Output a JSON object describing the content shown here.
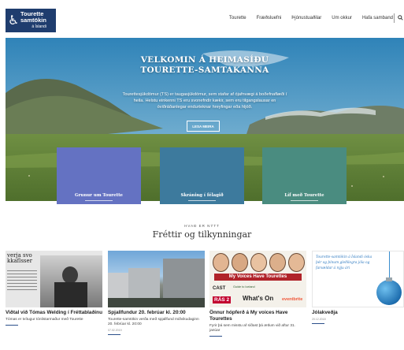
{
  "logo": {
    "line1": "Tourette",
    "line2": "samtökin",
    "line3": "á Íslandi"
  },
  "nav": {
    "items": [
      "Tourette",
      "Fræðsluefni",
      "Þjónustuaðilar",
      "Um okkur",
      "Hafa samband"
    ]
  },
  "hero": {
    "title_line1": "VELKOMIN Á HEIMASÍÐU",
    "title_line2": "TOURETTE-SAMTAKANNA",
    "text": "Tourettesjúkdómur (TS) er taugasjúkdómur, sem stafar af ójafnvægi á boðefnaflæði í heila. Helstu einkenni TS eru svonefndir kækir, sem eru tilgangslausar en óviðráðanlegar endurteknar hreyfingar eða hljóð.",
    "button": "LESA MEIRA"
  },
  "tiles": [
    {
      "label": "Grunur um Tourette",
      "color": "#6472c2"
    },
    {
      "label": "Skráning í félagið",
      "color": "#3d7a9d"
    },
    {
      "label": "Líf með Tourette",
      "color": "#4a8c80"
    }
  ],
  "news": {
    "eyebrow": "HVAÐ ER NÝTT",
    "title": "Fréttir og tilkynningar",
    "cards": [
      {
        "title": "Viðtal við Tómas Welding í Fréttablaðinu",
        "excerpt": "Tómas er tvítugur tónlistarmaður með Tourette",
        "date": "",
        "thumb_text": "verja svo\nkkaflsser"
      },
      {
        "title": "Spjallfundur 20. febrúar kl. 20:00",
        "excerpt": "Tourette-samtökin verða með spjallfund miðvikudaginn 20. febrúar kl. 20:00",
        "date": "07.02.2019"
      },
      {
        "title": "Önnur hópferð á My voices Have Tourettes",
        "excerpt": "Fyrir þá sem misstu af síðast þá ætlum við aftur 31. janúar",
        "date": "",
        "thumb_banner": "My Voices Have Tourettes",
        "thumb_brand": "What's On",
        "thumb_brand2": "eventbrite",
        "thumb_logo1": "CAST",
        "thumb_logo2": "Guide to Iceland",
        "thumb_logo3": "RÁS 2"
      },
      {
        "title": "Jólakveðja",
        "excerpt": "",
        "date": "20.12.2018",
        "thumb_text": "Tourette-samtökin á Íslandi óska þér og þínum gleðilegra jóla og farsældar á nýju ári"
      }
    ]
  }
}
